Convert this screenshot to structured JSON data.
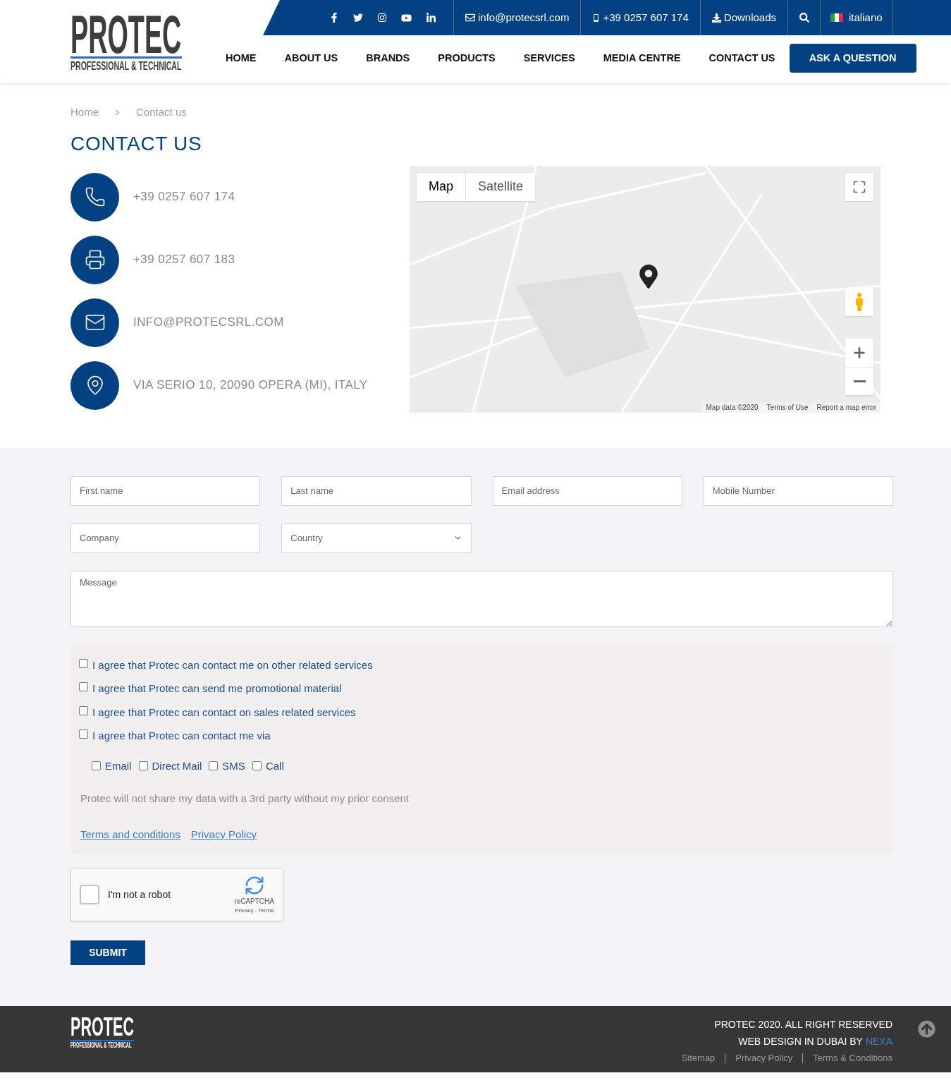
{
  "logo": {
    "title": "PROTEC",
    "subtitle": "PROFESSIONAL & TECHNICAL"
  },
  "topbar": {
    "email": "info@protecsrl.com",
    "phone": "+39 0257 607 174",
    "downloads": "Downloads",
    "language": "italiano"
  },
  "nav": {
    "items": [
      "HOME",
      "ABOUT US",
      "BRANDS",
      "PRODUCTS",
      "SERVICES",
      "MEDIA CENTRE",
      "CONTACT US"
    ],
    "cta": "ASK A QUESTION"
  },
  "breadcrumb": [
    "Home",
    "Contact us"
  ],
  "heading": "CONTACT US",
  "contacts": [
    {
      "kind": "phone",
      "text": "+39 0257 607 174"
    },
    {
      "kind": "fax",
      "text": "+39 0257 607 183"
    },
    {
      "kind": "email",
      "text": "INFO@PROTECSRL.COM"
    },
    {
      "kind": "address",
      "text": "VIA SERIO 10, 20090 OPERA (MI), ITALY"
    }
  ],
  "map": {
    "tabs": [
      {
        "label": "Map",
        "selected": true
      },
      {
        "label": "Satellite",
        "selected": false
      }
    ],
    "attribution": [
      "Map data ©2020",
      "Terms of Use",
      "Report a map error"
    ]
  },
  "form": {
    "fields": [
      {
        "kind": "input",
        "placeholder": "First name"
      },
      {
        "kind": "input",
        "placeholder": "Last name"
      },
      {
        "kind": "input",
        "placeholder": "Email address"
      },
      {
        "kind": "input",
        "placeholder": "Mobile Number"
      },
      {
        "kind": "input",
        "placeholder": "Company"
      },
      {
        "kind": "select",
        "placeholder": "Country"
      }
    ],
    "message": {
      "placeholder": "Message"
    },
    "consents": [
      {
        "label": "I agree that Protec can contact me on other related services",
        "checked": false
      },
      {
        "label": "I agree that Protec can send me promotional material",
        "checked": false
      },
      {
        "label": "I agree that Protec can contact on sales related services",
        "checked": false
      },
      {
        "label": "I agree that Protec can contact me via",
        "checked": false
      }
    ],
    "channels": [
      {
        "label": "Email",
        "checked": false
      },
      {
        "label": "Direct Mail",
        "checked": false
      },
      {
        "label": "SMS",
        "checked": false
      },
      {
        "label": "Call",
        "checked": false
      }
    ],
    "note": "Protec will not share my data with a 3rd party without my prior consent",
    "links": [
      "Terms and conditions",
      "Privacy Policy"
    ],
    "captcha": {
      "label": "I'm not a robot",
      "checked": false,
      "brand": "reCAPTCHA",
      "links": "Privacy - Terms"
    },
    "submit": "SUBMIT"
  },
  "footer": {
    "logo": {
      "title": "PROTEC",
      "subtitle": "PROFESSIONAL & TECHNICAL"
    },
    "copyright": "PROTEC 2020. ALL RIGHT RESERVED",
    "credit": "WEB DESIGN IN DUBAI BY",
    "credit_link": "NEXA",
    "links": [
      "Sitemap",
      "Privacy Policy",
      "Terms & Conditions"
    ]
  }
}
